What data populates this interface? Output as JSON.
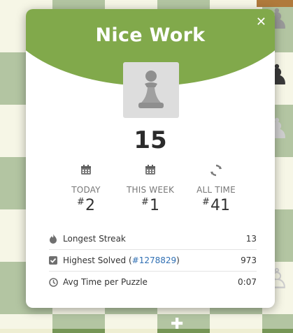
{
  "modal": {
    "title": "Nice Work",
    "close_glyph": "✕",
    "avatar_icon": "pawn-icon",
    "score": "15"
  },
  "ranks": [
    {
      "label": "TODAY",
      "prefix": "#",
      "value": "2",
      "icon": "calendar-icon"
    },
    {
      "label": "THIS WEEK",
      "prefix": "#",
      "value": "1",
      "icon": "calendar-icon"
    },
    {
      "label": "ALL TIME",
      "prefix": "#",
      "value": "41",
      "icon": "refresh-icon"
    }
  ],
  "stats": [
    {
      "label": "Longest Streak",
      "value": "13",
      "icon": "flame-icon"
    },
    {
      "label": "Highest Solved",
      "link_open": "(",
      "link": "#1278829",
      "link_close": ")",
      "value": "973",
      "icon": "checkbox-icon"
    },
    {
      "label": "Avg Time per Puzzle",
      "value": "0:07",
      "icon": "clock-icon"
    }
  ],
  "colors": {
    "header": "#81a94b",
    "board_dark": "#769656",
    "board_light": "#eeeed2",
    "link": "#2f6fb3"
  }
}
